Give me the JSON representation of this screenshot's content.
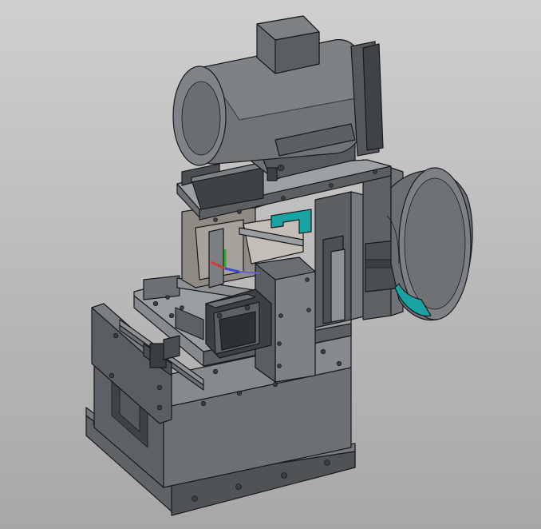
{
  "viewport": {
    "background_top": "#cfcfcf",
    "background_bottom": "#a7a7a7",
    "model_color": "#6b6e73",
    "accent_color": "#1aa3a3"
  },
  "model": {
    "parts": [
      "motor",
      "motor-junction-box",
      "motor-mount",
      "pulley-guard",
      "upper-plate",
      "vertical-column",
      "slide-carriage",
      "cylinder-block",
      "work-table",
      "base-frame",
      "base-plate",
      "linear-rail-left",
      "coordinate-triad"
    ]
  }
}
